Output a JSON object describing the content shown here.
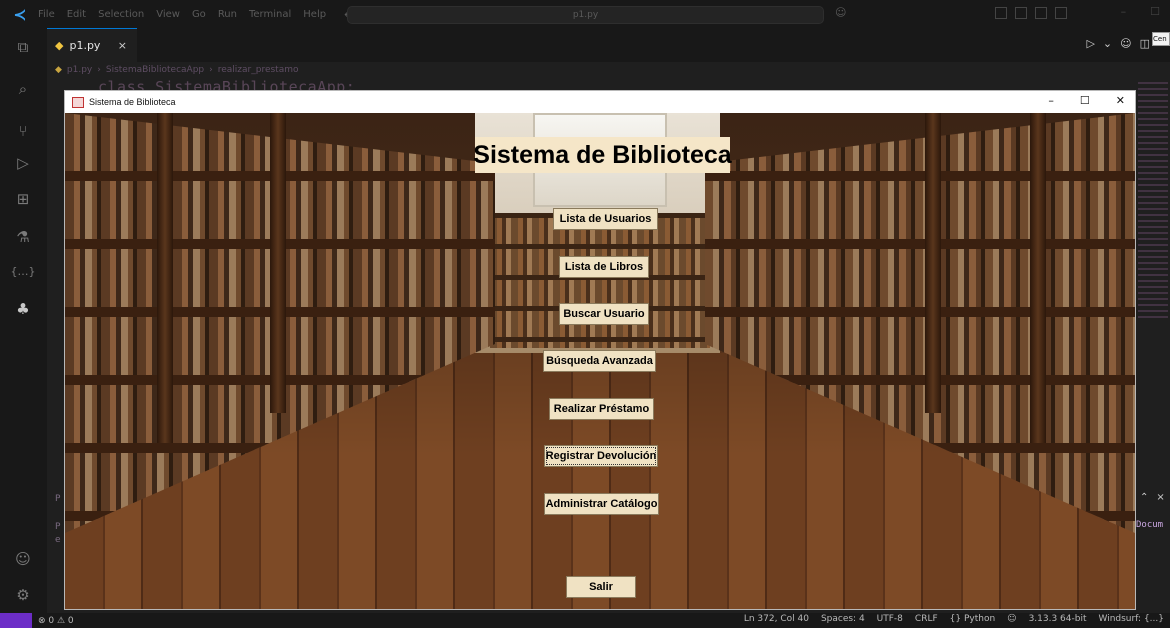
{
  "ide": {
    "menu": [
      "File",
      "Edit",
      "Selection",
      "View",
      "Go",
      "Run",
      "Terminal",
      "Help"
    ],
    "search_placeholder": "p1.py",
    "tab_label": "p1.py",
    "tab_close": "×",
    "breadcrumbs": [
      "p1.py",
      "SistemaBibliotecaApp",
      "realizar_prestamo"
    ],
    "code_line": "class SistemaBibliotecaApp:",
    "tooltip": "Cen",
    "panel_text": "Docum",
    "left_fragments": [
      "P",
      "P",
      "e"
    ]
  },
  "status_bar": {
    "problems": "⊗ 0 ⚠ 0",
    "position": "Ln 372, Col 40",
    "spaces": "Spaces: 4",
    "encoding": "UTF-8",
    "eol": "CRLF",
    "language": "{} Python",
    "interpreter": "3.13.3 64-bit",
    "extension": "Windsurf: {...}"
  },
  "window": {
    "title": "Sistema de Biblioteca",
    "minimize": "–",
    "maximize": "☐",
    "close": "✕"
  },
  "app": {
    "heading": "Sistema de Biblioteca",
    "buttons": {
      "usuarios": "Lista de Usuarios",
      "libros": "Lista de Libros",
      "buscar": "Buscar Usuario",
      "avanzada": "Búsqueda Avanzada",
      "prestamo": "Realizar Préstamo",
      "devolucion": "Registrar Devolución",
      "catalogo": "Administrar Catálogo",
      "salir": "Salir"
    }
  },
  "colors": {
    "button_bg": "#f0e2c3",
    "status_remote": "#6c2dc7"
  }
}
